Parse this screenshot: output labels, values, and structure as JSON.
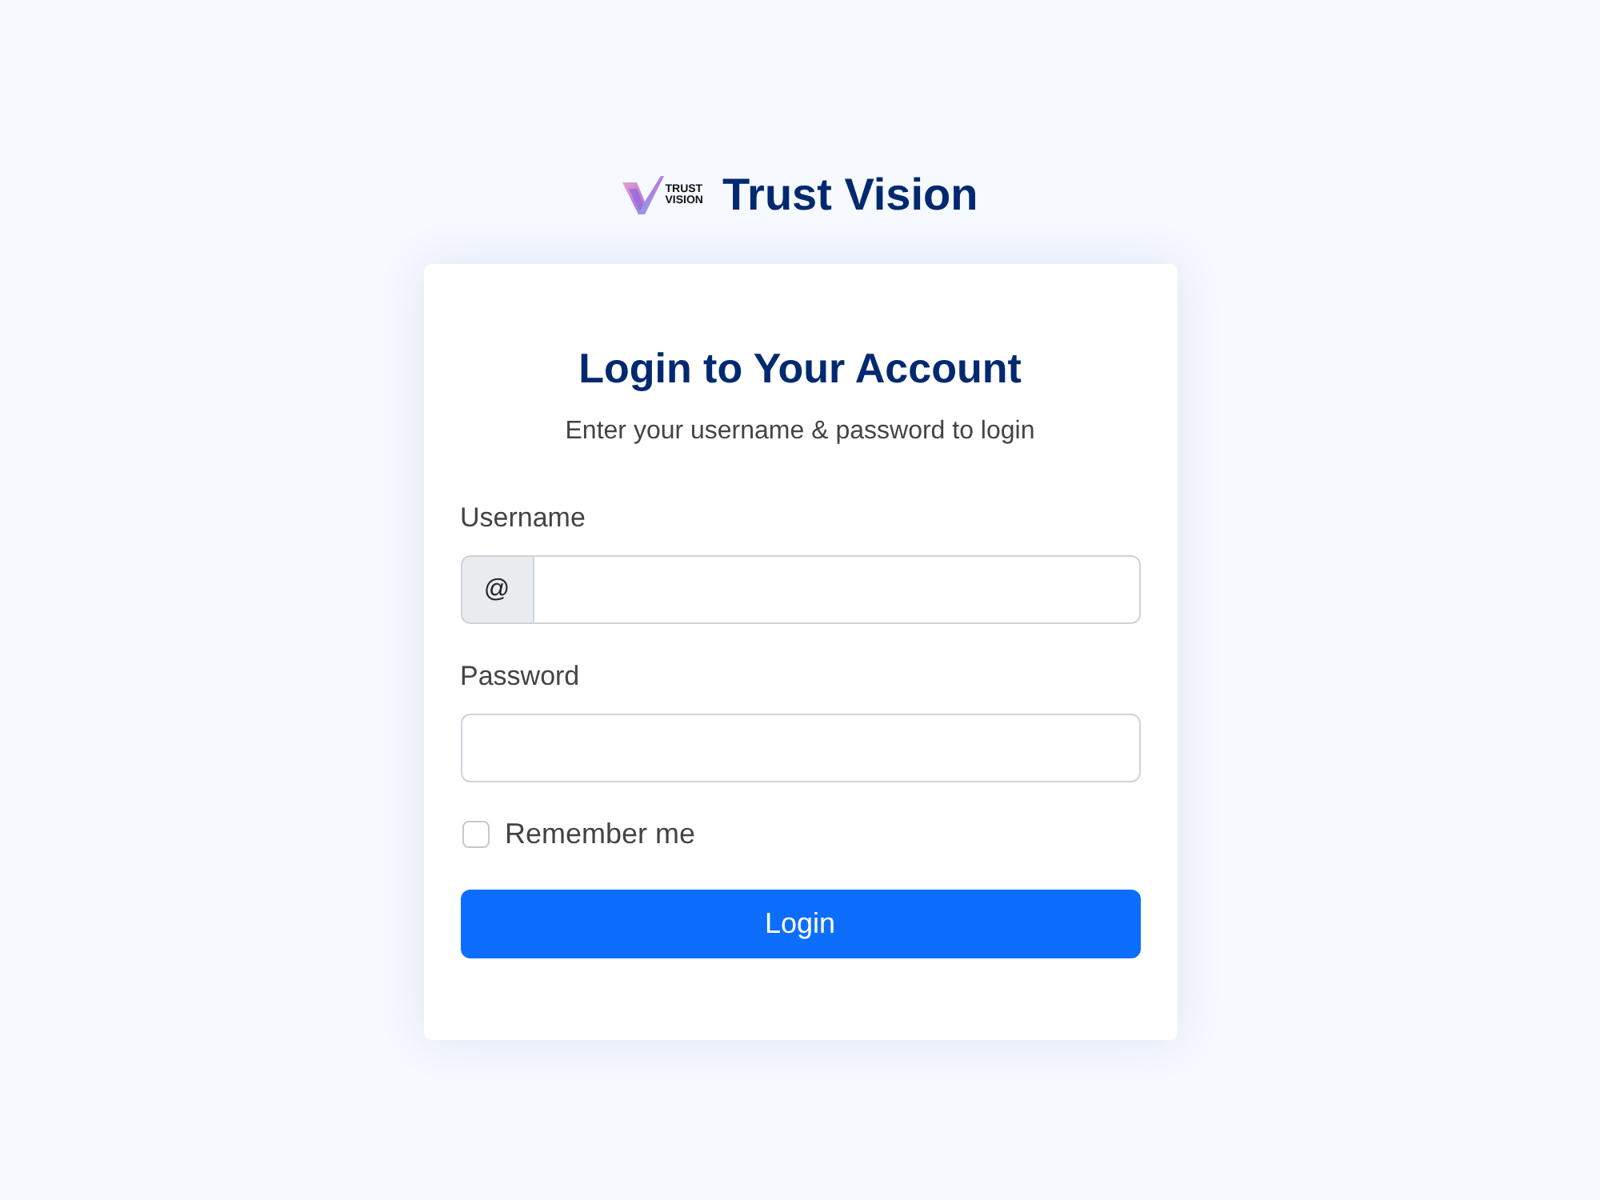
{
  "brand": {
    "logo_words": [
      "TRUST",
      "VISION"
    ],
    "name": "Trust Vision"
  },
  "card": {
    "title": "Login to Your Account",
    "subtitle": "Enter your username & password to login"
  },
  "fields": [
    {
      "kind": "prefixed",
      "label": "Username",
      "prefix": "@"
    },
    {
      "kind": "password",
      "label": "Password"
    }
  ],
  "remember": {
    "label": "Remember me",
    "checked": false
  },
  "submit": {
    "label": "Login"
  }
}
